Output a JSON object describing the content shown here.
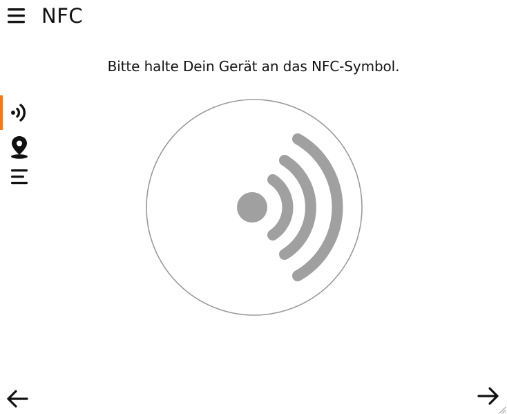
{
  "header": {
    "title": "NFC",
    "menu_icon": "hamburger-menu-icon"
  },
  "main": {
    "instruction": "Bitte halte Dein Gerät an das NFC-Symbol."
  },
  "sidebar": {
    "items": [
      {
        "icon": "nfc-icon",
        "active": true
      },
      {
        "icon": "location-pin-icon",
        "active": false
      },
      {
        "icon": "list-icon",
        "active": false
      }
    ],
    "accent_color": "#f27a1a"
  },
  "nfc_graphic": {
    "icon": "nfc-signal-icon",
    "circle_color": "#9a9a9a",
    "symbol_color": "#a0a0a0"
  },
  "footer": {
    "back_icon": "arrow-left-icon",
    "forward_icon": "arrow-right-icon"
  }
}
